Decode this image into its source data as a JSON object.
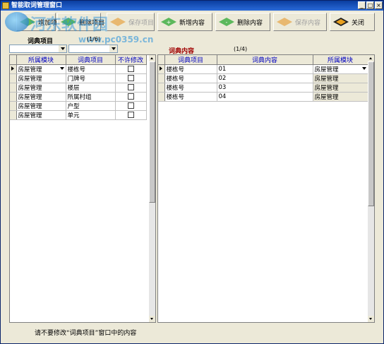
{
  "window": {
    "title": "智能取词管理窗口"
  },
  "toolbar": {
    "buttons": [
      {
        "label": "增加项目",
        "enabled": true,
        "icon": "add-item-icon"
      },
      {
        "label": "删除项目",
        "enabled": true,
        "icon": "delete-item-icon"
      },
      {
        "label": "保存项目",
        "enabled": false,
        "icon": "save-item-icon"
      },
      {
        "label": "新增内容",
        "enabled": true,
        "icon": "add-content-icon"
      },
      {
        "label": "删除内容",
        "enabled": true,
        "icon": "delete-content-icon"
      },
      {
        "label": "保存内容",
        "enabled": false,
        "icon": "save-content-icon"
      },
      {
        "label": "关闭",
        "enabled": true,
        "icon": "close-icon"
      }
    ]
  },
  "watermark": {
    "text": "河东软件园",
    "url": "www.pc0359.cn"
  },
  "left": {
    "title": "词典项目",
    "count": "(1/6)",
    "filter1": "",
    "filter2": "",
    "columns": [
      "所属模块",
      "词典项目",
      "不许修改"
    ],
    "rows": [
      {
        "module": "房屋管理",
        "item": "楼栋号",
        "locked": false
      },
      {
        "module": "房屋管理",
        "item": "门牌号",
        "locked": false
      },
      {
        "module": "房屋管理",
        "item": "楼层",
        "locked": false
      },
      {
        "module": "房屋管理",
        "item": "所属村组",
        "locked": false
      },
      {
        "module": "房屋管理",
        "item": "户型",
        "locked": false
      },
      {
        "module": "房屋管理",
        "item": "单元",
        "locked": false
      }
    ]
  },
  "right": {
    "title": "词典内容",
    "count": "(1/4)",
    "columns": [
      "词典项目",
      "词典内容",
      "所属模块"
    ],
    "rows": [
      {
        "item": "楼栋号",
        "content": "01",
        "module": "房屋管理"
      },
      {
        "item": "楼栋号",
        "content": "02",
        "module": "房屋管理"
      },
      {
        "item": "楼栋号",
        "content": "03",
        "module": "房屋管理"
      },
      {
        "item": "楼栋号",
        "content": "04",
        "module": "房屋管理"
      }
    ]
  },
  "status": {
    "text": "请不要修改“词典项目”窗口中的内容"
  }
}
